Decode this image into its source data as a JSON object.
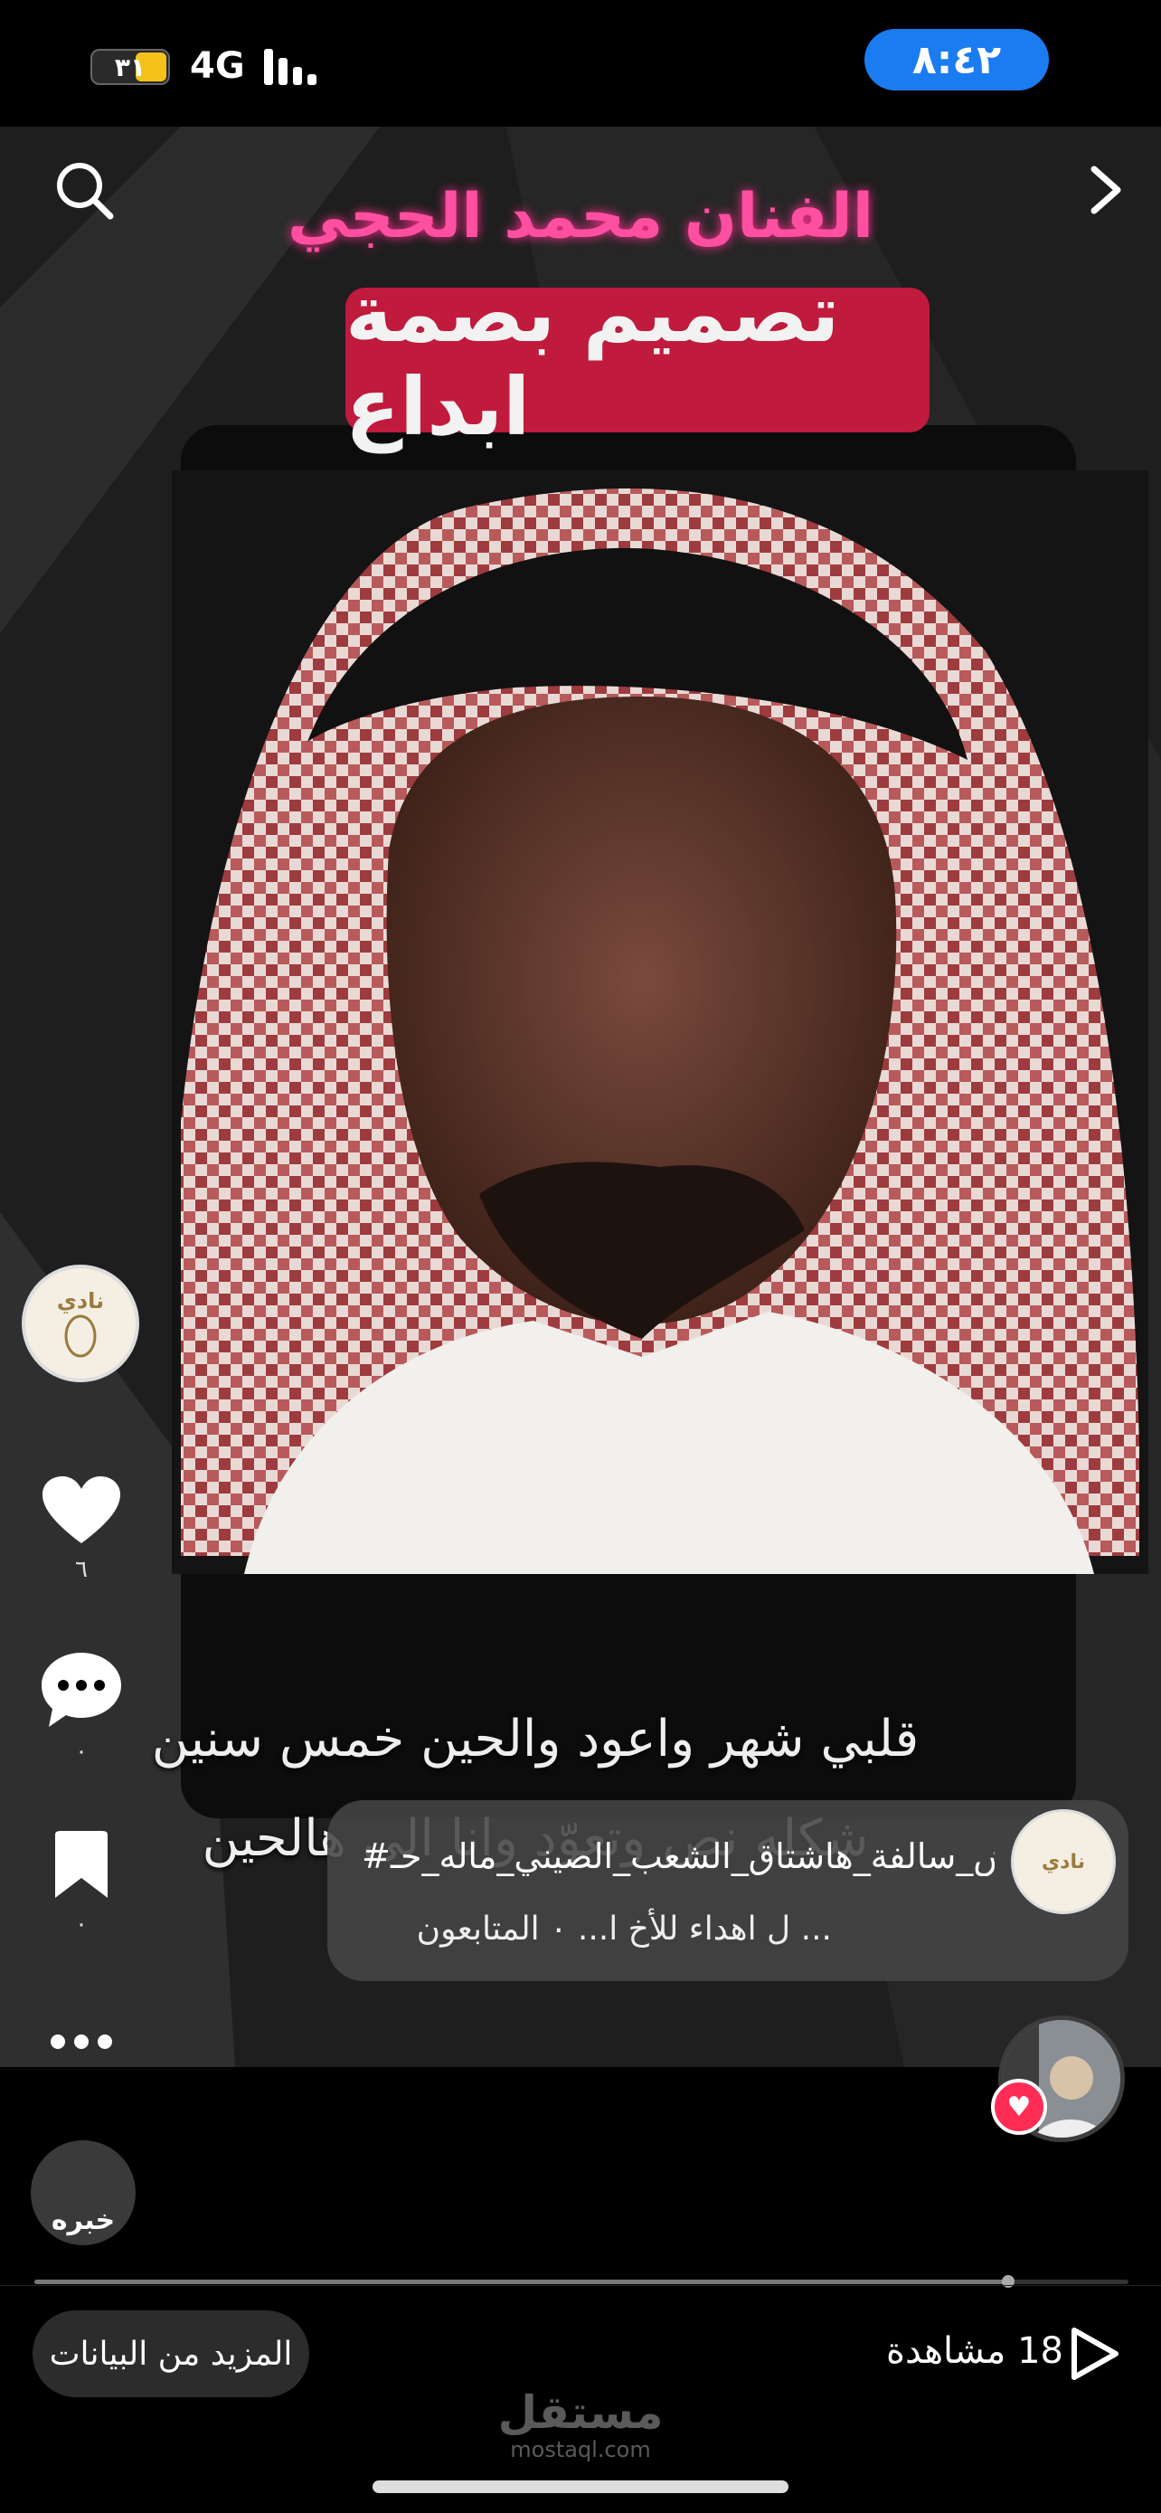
{
  "status_bar": {
    "time": "٨:٤٢",
    "battery": "٣١",
    "network": "4G"
  },
  "video": {
    "title_overlay": "الفنان محمد الحجي",
    "banner_text": "تصميم بصمة ابداع",
    "lyrics": {
      "line1": "قلبي شهر واعود والحين خمس سنين",
      "line2": "شكله نص وتعوّد وانا الى هالحين"
    }
  },
  "top_controls": {
    "search_icon": "search-icon",
    "forward_icon": "chevron-right-icon"
  },
  "sidebar": {
    "creator_avatar_text": "نادي",
    "likes_count": "٦",
    "comments_count": "٠",
    "saves_count": "٠"
  },
  "description": {
    "line1": "#وش_سالفة_هاشتاق_الشعب_الصيني_ماله_حـ",
    "line2": "ل اهداء للأخ ا... ٠ المتابعون ..."
  },
  "music": {
    "avatar_text": "خبره"
  },
  "progress": {
    "fraction": 0.89
  },
  "bottom_bar": {
    "more_data_label": "المزيد من البيانات",
    "views_count": "18",
    "views_label": "مشاهدة"
  },
  "watermark": {
    "brand_ar": "مستقل",
    "brand_en": "mostaql.com"
  },
  "colors": {
    "accent_pink": "#ff4fa0",
    "banner_red": "#c01a3c",
    "time_pill": "#1a7cf0",
    "heart_red": "#ff2d55"
  }
}
